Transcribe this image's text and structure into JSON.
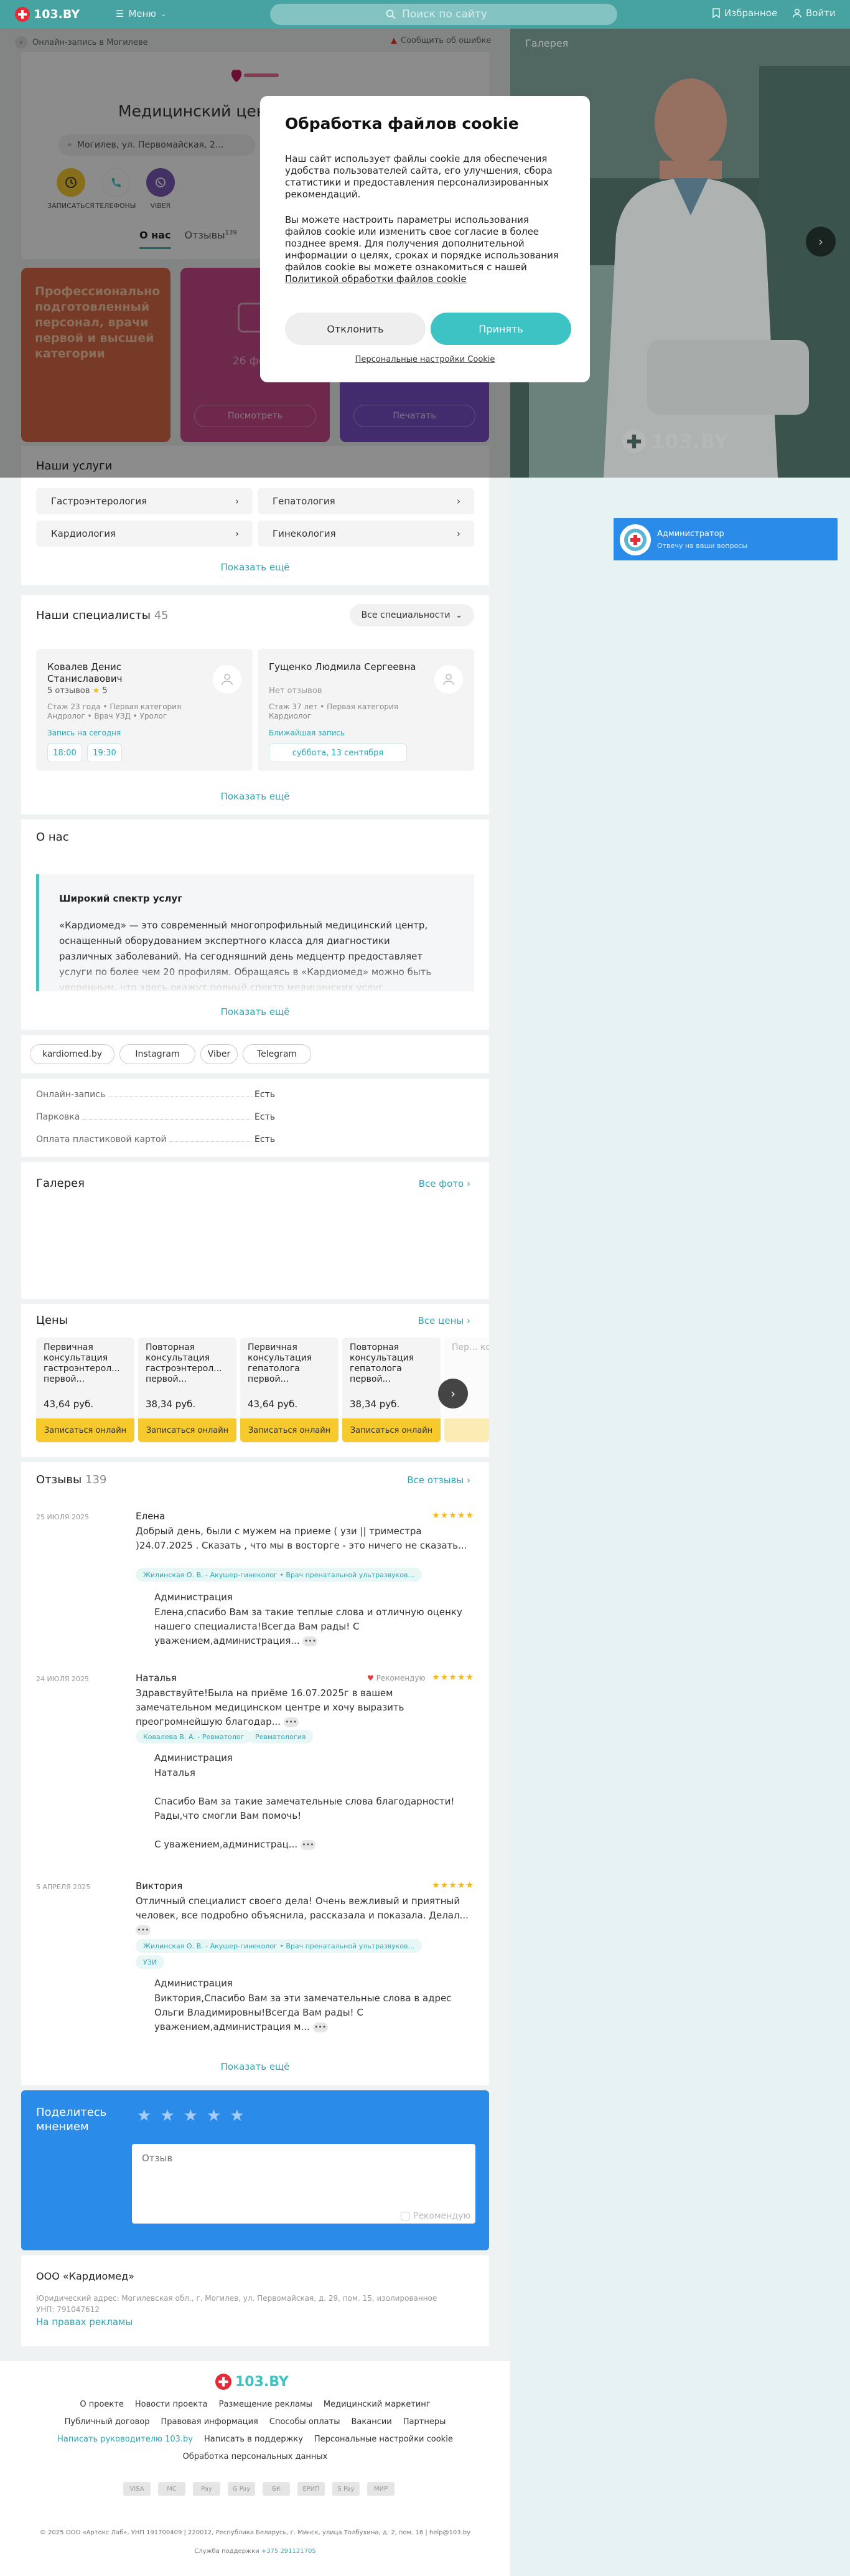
{
  "header": {
    "logo": "103.BY",
    "menu": "Меню",
    "search_placeholder": "Поиск по сайту",
    "favorites": "Избранное",
    "login": "Войти"
  },
  "breadcrumb": {
    "back": "‹",
    "label": "Онлайн-запись в Могилеве",
    "report": "Сообщить об ошибке"
  },
  "clinic": {
    "title": "Медицинский центр «Кардиомед»",
    "address": "Могилев, ул. Первомайская, 2...",
    "actions": [
      {
        "label": "ЗАПИСАТЬСЯ",
        "color": "#f5c832"
      },
      {
        "label": "ТЕЛЕФОНЫ",
        "color": "#ffffff"
      },
      {
        "label": "VIBER",
        "color": "#7b59b6"
      }
    ],
    "tabs": [
      {
        "label": "О нас"
      },
      {
        "label": "Отзывы",
        "count": "139"
      }
    ]
  },
  "promos": [
    {
      "text": "Профессионально подготовленный персонал, врачи первой и высшей категории",
      "color": "#d96b45"
    },
    {
      "text": "26 фото",
      "button": "Посмотреть",
      "color": "#c94a8a"
    },
    {
      "text": "",
      "button": "Печатать",
      "color": "#7b51c8"
    }
  ],
  "services": {
    "title": "Наши услуги",
    "items": [
      "Гастроэнтерология",
      "Гепатология",
      "Кардиология",
      "Гинекология"
    ],
    "more": "Показать ещё"
  },
  "specialists": {
    "title": "Наши специалисты",
    "count": "45",
    "filter": "Все специальности",
    "doctors": [
      {
        "name": "Ковалев Денис Станиславович",
        "reviews": "5 отзывов",
        "rating": "5",
        "info": "Стаж 23 года • Первая категория Андролог • Врач УЗД • Уролог",
        "sub": "Запись на сегодня",
        "slots": [
          "18:00",
          "19:30"
        ]
      },
      {
        "name": "Гущенко Людмила Сергеевна",
        "reviews": "Нет отзывов",
        "rating": "",
        "info": "Стаж 37 лет • Первая категория Кардиолог",
        "sub": "Ближайшая запись",
        "slots": [
          "суббота, 13 сентября"
        ]
      }
    ],
    "more": "Показать ещё"
  },
  "about": {
    "title": "О нас",
    "heading": "Широкий спектр услуг",
    "text": "«Кардиомед» — это современный многопрофильный медицинский центр, оснащенный оборудованием экспертного класса для диагностики различных заболеваний. На сегодняшний день медцентр предоставляет услуги по более чем 20 профилям. Обращаясь в «Кардиомед» можно быть уверенным, что здесь окажут полный спектр медицинских услуг необходимых пациенту.",
    "more": "Показать ещё"
  },
  "links": [
    "kardiomed.by",
    "Instagram",
    "Viber",
    "Telegram"
  ],
  "features": [
    {
      "label": "Онлайн-запись",
      "value": "Есть"
    },
    {
      "label": "Парковка",
      "value": "Есть"
    },
    {
      "label": "Оплата пластиковой картой",
      "value": "Есть"
    }
  ],
  "gallery_section": {
    "title": "Галерея",
    "link": "Все фото"
  },
  "prices": {
    "title": "Цены",
    "link": "Все цены",
    "items": [
      {
        "name": "Первичная консультация гастроэнтерол... первой...",
        "value": "43,64 руб."
      },
      {
        "name": "Повторная консультация гастроэнтерол... первой...",
        "value": "38,34 руб."
      },
      {
        "name": "Первичная консультация гепатолога первой...",
        "value": "43,64 руб."
      },
      {
        "name": "Повторная консультация гепатолога первой...",
        "value": "38,34 руб."
      },
      {
        "name": "Пер... конс...",
        "value": ""
      }
    ],
    "button": "Записаться онлайн"
  },
  "reviews": {
    "title": "Отзывы",
    "count": "139",
    "link": "Все отзывы",
    "recommend": "Рекомендую",
    "items": [
      {
        "date": "25 ИЮЛЯ 2025",
        "name": "Елена",
        "stars": "★★★★★",
        "text": "Добрый день, были с мужем на приеме ( узи || триместра )24.07.2025 . Сказать , что мы в восторге - это ничего не сказать...",
        "tags": [
          "Жилинская О. В. - Акушер-гинеколог • Врач пренатальной ультразвуков..."
        ],
        "reply_author": "Администрация",
        "reply": "Елена,спасибо Вам за такие теплые слова и отличную оценку нашего специалиста!Всегда Вам рады! С уважением,администрация..."
      },
      {
        "date": "24 ИЮЛЯ 2025",
        "name": "Наталья",
        "stars": "★★★★★",
        "text": "Здравствуйте!Была на приёме 16.07.2025г в вашем замечательном медицинском центре и хочу выразить преогромнейшую благодар...",
        "tags": [
          "Ковалева В. А. - Ревматолог",
          "Ревматология"
        ],
        "reply_author": "Администрация",
        "reply": "Наталья\n\nСпасибо Вам за такие замечательные слова благодарности! Рады,что смогли Вам помочь!\n\nС уважением,администрац..."
      },
      {
        "date": "5 АПРЕЛЯ 2025",
        "name": "Виктория",
        "stars": "★★★★★",
        "text": "Отличный специалист своего дела! Очень вежливый и приятный человек, все подробно объяснила, рассказала и показала. Делал...",
        "tags": [
          "Жилинская О. В. - Акушер-гинеколог • Врач пренатальной ультразвуков...",
          "УЗИ"
        ],
        "reply_author": "Администрация",
        "reply": "Виктория,Спасибо Вам за эти замечательные слова в адрес Ольги Владимировны!Всегда Вам рады! С уважением,администрация м..."
      }
    ],
    "more": "Показать ещё"
  },
  "share": {
    "title": "Поделитесь мнением",
    "placeholder": "Отзыв",
    "recommend": "Рекомендую"
  },
  "company": {
    "name": "ООО «Кардиомед»",
    "legal": "Юридический адрес: Могилевская обл., г. Могилев, ул. Первомайская, д. 29, пом. 15, изолированное",
    "unp": "УНП: 791047612",
    "ad": "На правах рекламы"
  },
  "footer": {
    "logo": "103.BY",
    "row1": [
      "О проекте",
      "Новости проекта",
      "Размещение рекламы",
      "Медицинский маркетинг"
    ],
    "row2": [
      "Публичный договор",
      "Правовая информация",
      "Способы оплаты",
      "Вакансии",
      "Партнеры"
    ],
    "row3": [
      "Написать руководителю 103.by",
      "Написать в поддержку",
      "Персональные настройки cookie"
    ],
    "row4": [
      "Обработка персональных данных"
    ],
    "payments": [
      "Visa",
      "Mastercard",
      "Apple Pay",
      "Google Pay",
      "Белкарт",
      "ЕРИП",
      "Samsung Pay",
      "Mir"
    ],
    "copyright": "© 2025 ООО «Артокс Лаб», УНП 191700409 | 220012, Республика Беларусь, г. Минск, улица Толбухина, д. 2, пом. 16 | help@103.by",
    "support": "Служба поддержки",
    "phone": "+375 291121705"
  },
  "gallery": {
    "title": "Галерея",
    "watermark": "103.BY"
  },
  "admin": {
    "title": "Администратор",
    "subtitle": "Отвечу на ваши вопросы"
  },
  "cookie": {
    "title": "Обработка файлов cookie",
    "p1": "Наш сайт использует файлы cookie для обеспечения удобства пользователей сайта, его улучшения, сбора статистики и предоставления персонализированных рекомендаций.",
    "p2": "Вы можете настроить параметры использования файлов cookie или изменить свое согласие в более позднее время. Для получения дополнительной информации о целях, сроках и порядке использования файлов cookie вы можете ознакомиться с нашей",
    "policy": "Политикой обработки файлов cookie",
    "decline": "Отклонить",
    "accept": "Принять",
    "settings": "Персональные настройки Cookie"
  },
  "colors": {
    "header": "#47a3a1",
    "accent": "#3ec3c5",
    "link": "#2aa6b4",
    "share": "#2b8be8",
    "price_button": "#f6ca2d"
  }
}
